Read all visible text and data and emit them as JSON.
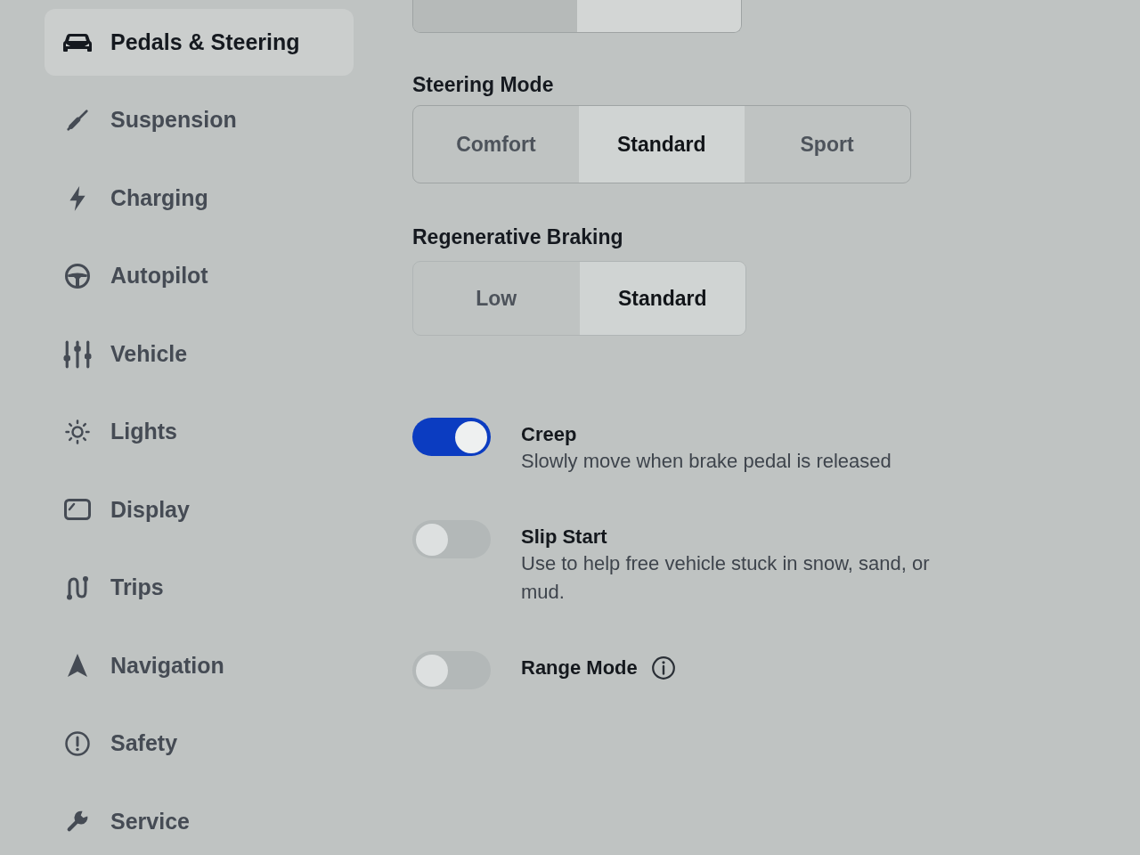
{
  "sidebar": {
    "items": [
      {
        "label": "Pedals & Steering",
        "selected": true
      },
      {
        "label": "Suspension",
        "selected": false
      },
      {
        "label": "Charging",
        "selected": false
      },
      {
        "label": "Autopilot",
        "selected": false
      },
      {
        "label": "Vehicle",
        "selected": false
      },
      {
        "label": "Lights",
        "selected": false
      },
      {
        "label": "Display",
        "selected": false
      },
      {
        "label": "Trips",
        "selected": false
      },
      {
        "label": "Navigation",
        "selected": false
      },
      {
        "label": "Safety",
        "selected": false
      },
      {
        "label": "Service",
        "selected": false
      }
    ]
  },
  "partial_selector": {
    "options": [
      {
        "selected": false
      },
      {
        "selected": true
      }
    ]
  },
  "sections": [
    {
      "title": "Steering Mode",
      "options": [
        {
          "label": "Comfort",
          "selected": false
        },
        {
          "label": "Standard",
          "selected": true
        },
        {
          "label": "Sport",
          "selected": false
        }
      ]
    },
    {
      "title": "Regenerative Braking",
      "options": [
        {
          "label": "Low",
          "selected": false
        },
        {
          "label": "Standard",
          "selected": true
        }
      ]
    }
  ],
  "toggles": [
    {
      "title": "Creep",
      "description": "Slowly move when brake pedal is released",
      "on": true
    },
    {
      "title": "Slip Start",
      "description": "Use to help free vehicle stuck in snow, sand, or mud.",
      "on": false
    },
    {
      "title": "Range Mode",
      "on": false,
      "info": true
    }
  ]
}
